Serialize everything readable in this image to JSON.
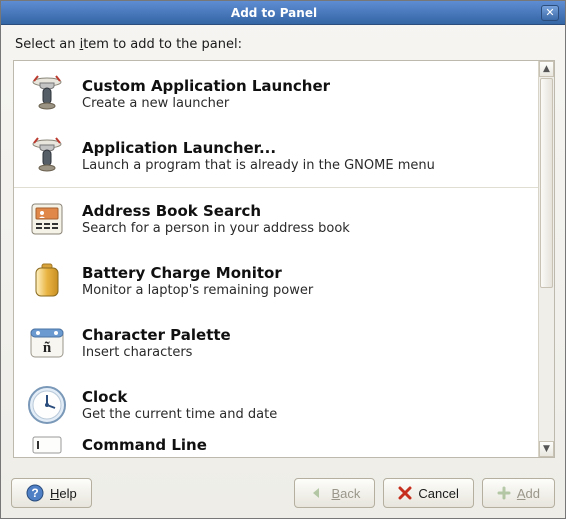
{
  "title": "Add to Panel",
  "prompt_pre": "Select an ",
  "prompt_key": "i",
  "prompt_post": "tem to add to the panel:",
  "items": [
    {
      "title": "Custom Application Launcher",
      "desc": "Create a new launcher"
    },
    {
      "title": "Application Launcher...",
      "desc": "Launch a program that is already in the GNOME menu"
    },
    {
      "title": "Address Book Search",
      "desc": "Search for a person in your address book"
    },
    {
      "title": "Battery Charge Monitor",
      "desc": "Monitor a laptop's remaining power"
    },
    {
      "title": "Character Palette",
      "desc": "Insert characters"
    },
    {
      "title": "Clock",
      "desc": "Get the current time and date"
    },
    {
      "title": "Command Line",
      "desc": ""
    }
  ],
  "buttons": {
    "help_key": "H",
    "help_rest": "elp",
    "back_key": "B",
    "back_rest": "ack",
    "cancel": "Cancel",
    "add_key": "A",
    "add_rest": "dd"
  }
}
